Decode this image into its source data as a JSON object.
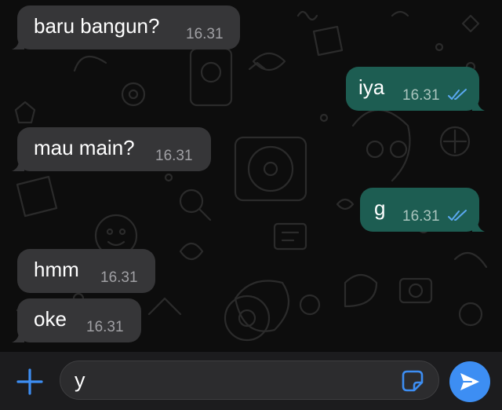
{
  "colors": {
    "incoming_bubble": "#363638",
    "outgoing_bubble": "#1d5d52",
    "read_ticks": "#5aa8f0",
    "accent_blue": "#3d8ef3"
  },
  "messages": [
    {
      "direction": "incoming",
      "text": "baru bangun?",
      "time": "16.31"
    },
    {
      "direction": "outgoing",
      "text": "iya",
      "time": "16.31",
      "status": "read"
    },
    {
      "direction": "incoming",
      "text": "mau main?",
      "time": "16.31"
    },
    {
      "direction": "outgoing",
      "text": "g",
      "time": "16.31",
      "status": "read"
    },
    {
      "direction": "incoming",
      "text": "hmm",
      "time": "16.31"
    },
    {
      "direction": "incoming",
      "text": "oke",
      "time": "16.31"
    }
  ],
  "composer": {
    "input_value": "y",
    "attach_icon": "plus-icon",
    "sticker_icon": "sticker-icon",
    "send_icon": "send-arrow-icon"
  }
}
